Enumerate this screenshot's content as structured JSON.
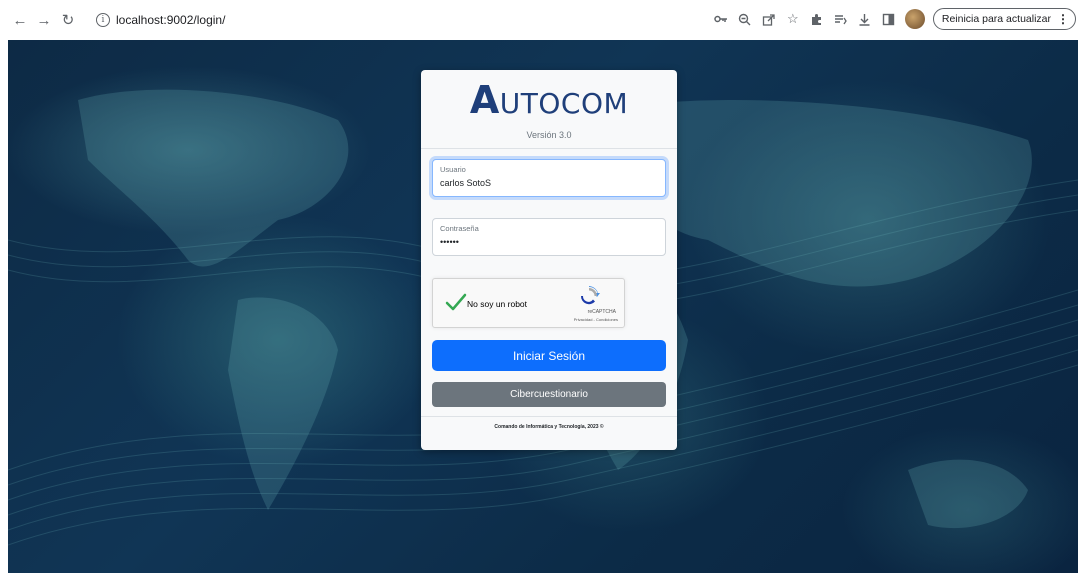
{
  "browser": {
    "url": "localhost:9002/login/",
    "update_button": "Reinicia para actualizar",
    "icons": [
      "back-arrow-icon",
      "forward-arrow-icon",
      "reload-icon",
      "site-info-icon",
      "key-icon",
      "zoom-icon",
      "share-icon",
      "star-icon",
      "extensions-icon",
      "reading-list-icon",
      "download-icon",
      "side-panel-icon",
      "profile-avatar",
      "more-menu-icon"
    ]
  },
  "login": {
    "logo_first": "A",
    "logo_rest": "UTOCOM",
    "version": "Versión 3.0",
    "username": {
      "label": "Usuario",
      "value": "carlos SotoS"
    },
    "password": {
      "label": "Contraseña",
      "value": "••••••"
    },
    "captcha": {
      "text": "No soy un robot",
      "brand": "reCAPTCHA",
      "links": "Privacidad - Condiciones"
    },
    "submit_label": "Iniciar Sesión",
    "secondary_label": "Cibercuestionario",
    "footer": "Comando de Informática y Tecnología, 2023 ©"
  },
  "colors": {
    "primary": "#0d6efd",
    "secondary": "#6c757d",
    "logo": "#1f3f7a",
    "background": "#0d2a45"
  }
}
